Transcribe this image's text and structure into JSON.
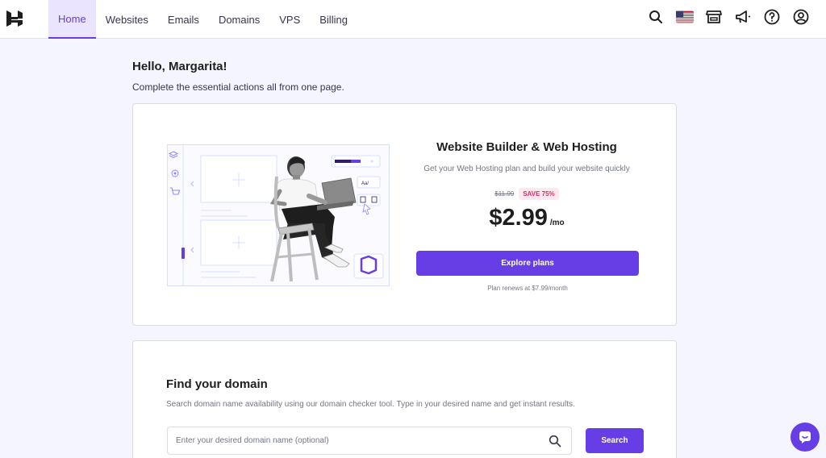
{
  "nav": {
    "items": [
      {
        "label": "Home",
        "active": true
      },
      {
        "label": "Websites",
        "active": false
      },
      {
        "label": "Emails",
        "active": false
      },
      {
        "label": "Domains",
        "active": false
      },
      {
        "label": "VPS",
        "active": false
      },
      {
        "label": "Billing",
        "active": false
      }
    ]
  },
  "header_icons": [
    "search-icon",
    "us-flag-icon",
    "store-icon",
    "megaphone-icon",
    "help-icon",
    "account-icon"
  ],
  "greeting": "Hello, Margarita!",
  "subtitle": "Complete the essential actions all from one page.",
  "hosting": {
    "title": "Website Builder & Web Hosting",
    "description": "Get your Web Hosting plan and build your website quickly",
    "old_price": "$11.99",
    "save_badge": "SAVE 75%",
    "price": "$2.99",
    "per": "/mo",
    "cta": "Explore plans",
    "renews": "Plan renews at $7.99/month",
    "illustration_label": "Aa/"
  },
  "domain": {
    "title": "Find your domain",
    "description": "Search domain name availability using our domain checker tool. Type in your desired name and get instant results.",
    "placeholder": "Enter your desired domain name (optional)",
    "button": "Search"
  },
  "colors": {
    "accent": "#673de6",
    "accent_light": "#ebe4ff",
    "save_badge_text": "#d63163",
    "save_badge_bg": "#ffe8ef",
    "page_bg": "#f4f5ff"
  }
}
